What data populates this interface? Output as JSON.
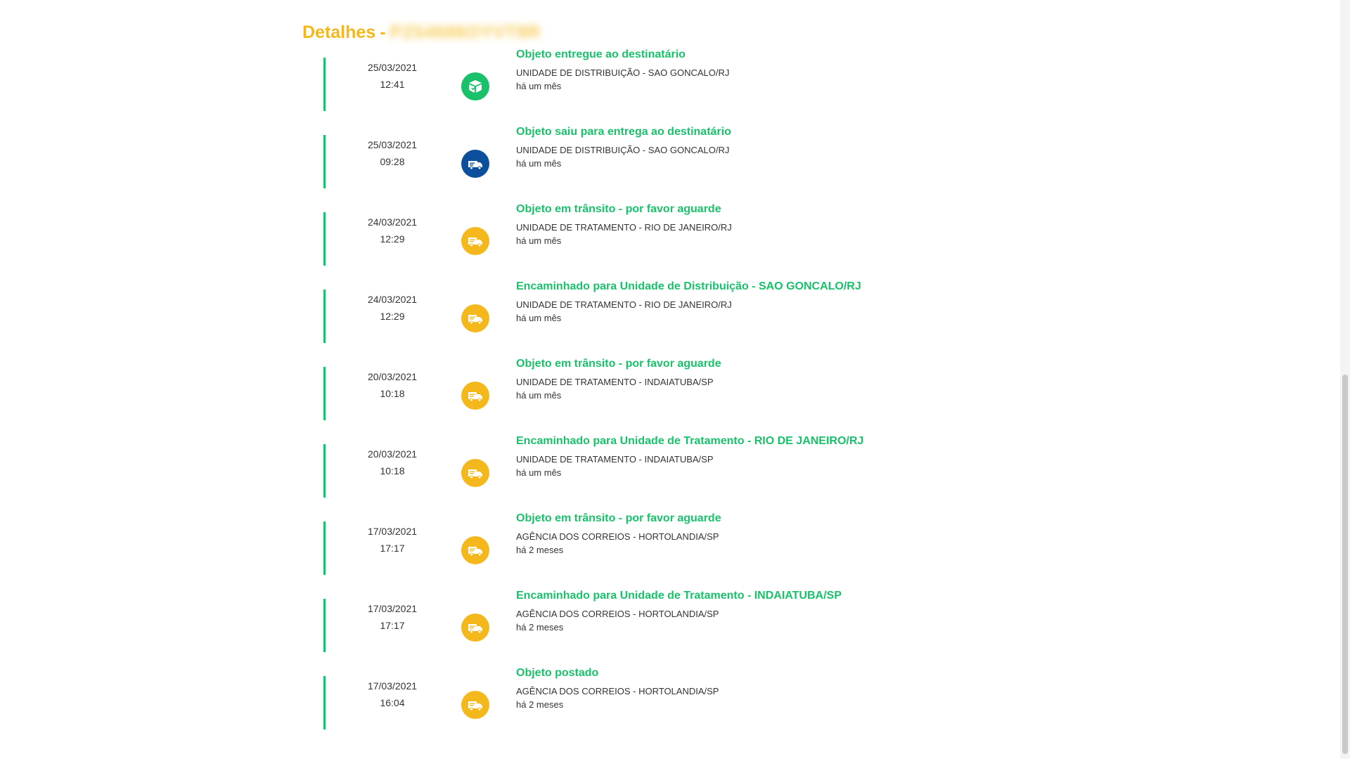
{
  "header": {
    "title": "Detalhes",
    "separator": "-",
    "tracking_code": "PZ54686OYVT8R"
  },
  "events": [
    {
      "date": "25/03/2021",
      "time": "12:41",
      "icon": "delivered-box-icon",
      "status": "delivered",
      "title": "Objeto entregue ao destinatário",
      "unit": "UNIDADE DE DISTRIBUIÇÃO - SAO GONCALO/RJ",
      "ago": "há um mês"
    },
    {
      "date": "25/03/2021",
      "time": "09:28",
      "icon": "delivery-van-icon",
      "status": "out",
      "title": "Objeto saiu para entrega ao destinatário",
      "unit": "UNIDADE DE DISTRIBUIÇÃO - SAO GONCALO/RJ",
      "ago": "há um mês"
    },
    {
      "date": "24/03/2021",
      "time": "12:29",
      "icon": "truck-icon",
      "status": "transit",
      "title": "Objeto em trânsito - por favor aguarde",
      "unit": "UNIDADE DE TRATAMENTO - RIO DE JANEIRO/RJ",
      "ago": "há um mês"
    },
    {
      "date": "24/03/2021",
      "time": "12:29",
      "icon": "truck-icon",
      "status": "transit",
      "title": "Encaminhado para Unidade de Distribuição - SAO GONCALO/RJ",
      "unit": "UNIDADE DE TRATAMENTO - RIO DE JANEIRO/RJ",
      "ago": "há um mês"
    },
    {
      "date": "20/03/2021",
      "time": "10:18",
      "icon": "truck-icon",
      "status": "transit",
      "title": "Objeto em trânsito - por favor aguarde",
      "unit": "UNIDADE DE TRATAMENTO - INDAIATUBA/SP",
      "ago": "há um mês"
    },
    {
      "date": "20/03/2021",
      "time": "10:18",
      "icon": "truck-icon",
      "status": "transit",
      "title": "Encaminhado para Unidade de Tratamento - RIO DE JANEIRO/RJ",
      "unit": "UNIDADE DE TRATAMENTO - INDAIATUBA/SP",
      "ago": "há um mês"
    },
    {
      "date": "17/03/2021",
      "time": "17:17",
      "icon": "truck-icon",
      "status": "transit",
      "title": "Objeto em trânsito - por favor aguarde",
      "unit": "AGÊNCIA DOS CORREIOS - HORTOLANDIA/SP",
      "ago": "há 2 meses"
    },
    {
      "date": "17/03/2021",
      "time": "17:17",
      "icon": "truck-icon",
      "status": "transit",
      "title": "Encaminhado para Unidade de Tratamento - INDAIATUBA/SP",
      "unit": "AGÊNCIA DOS CORREIOS - HORTOLANDIA/SP",
      "ago": "há 2 meses"
    },
    {
      "date": "17/03/2021",
      "time": "16:04",
      "icon": "truck-icon",
      "status": "transit",
      "title": "Objeto postado",
      "unit": "AGÊNCIA DOS CORREIOS - HORTOLANDIA/SP",
      "ago": "há 2 meses"
    }
  ],
  "colors": {
    "accent_yellow": "#f5b81c",
    "accent_green": "#19c16a",
    "accent_blue": "#0c4f9d"
  }
}
